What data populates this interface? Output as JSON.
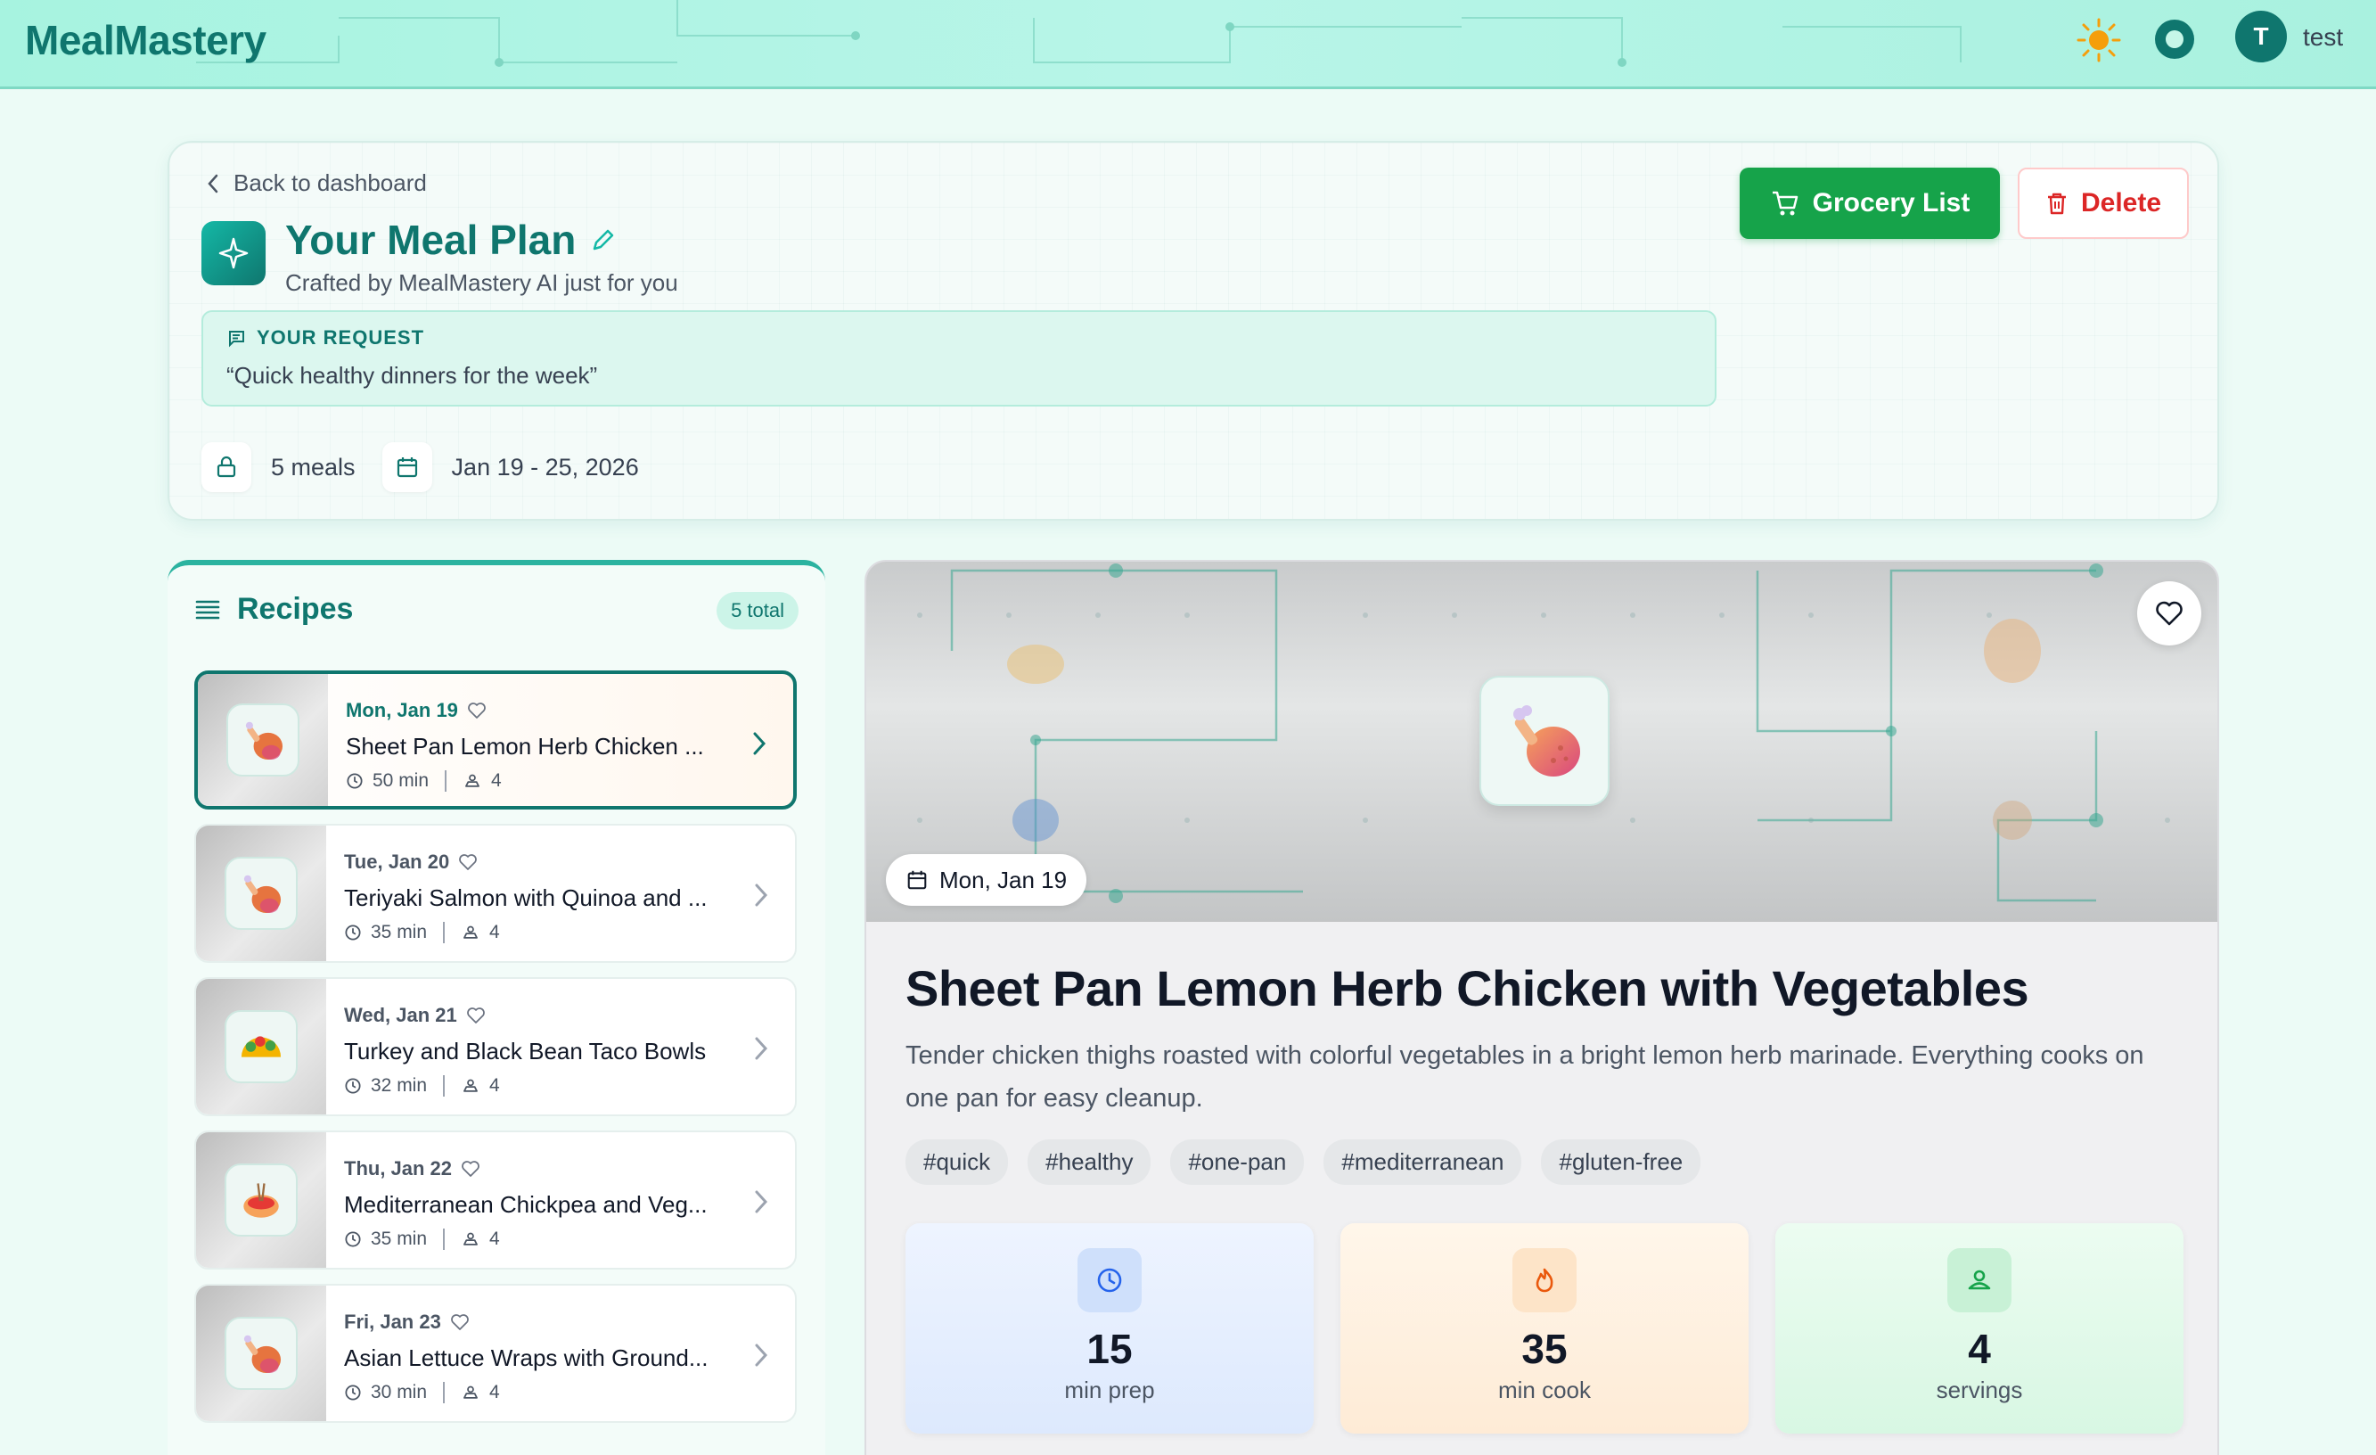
{
  "app": {
    "brand": "MealMastery"
  },
  "user": {
    "initial": "T",
    "name": "test"
  },
  "header": {
    "back_label": "Back to dashboard",
    "title": "Your Meal Plan",
    "subtitle": "Crafted by MealMastery AI just for you",
    "request_label": "YOUR REQUEST",
    "request_text": "“Quick healthy dinners for the week”",
    "meals_count": "5 meals",
    "date_range": "Jan 19 - 25, 2026",
    "grocery_label": "Grocery List",
    "delete_label": "Delete"
  },
  "recipes": {
    "heading": "Recipes",
    "total_badge": "5 total",
    "items": [
      {
        "day": "Mon, Jan 19",
        "name": "Sheet Pan Lemon Herb Chicken ...",
        "time": "50 min",
        "servings": "4",
        "icon": "chicken-leg-icon"
      },
      {
        "day": "Tue, Jan 20",
        "name": "Teriyaki Salmon with Quinoa and ...",
        "time": "35 min",
        "servings": "4",
        "icon": "chicken-leg-icon"
      },
      {
        "day": "Wed, Jan 21",
        "name": "Turkey and Black Bean Taco Bowls",
        "time": "32 min",
        "servings": "4",
        "icon": "taco-icon"
      },
      {
        "day": "Thu, Jan 22",
        "name": "Mediterranean Chickpea and Veg...",
        "time": "35 min",
        "servings": "4",
        "icon": "noodle-bowl-icon"
      },
      {
        "day": "Fri, Jan 23",
        "name": "Asian Lettuce Wraps with Ground...",
        "time": "30 min",
        "servings": "4",
        "icon": "chicken-leg-icon"
      }
    ]
  },
  "detail": {
    "date": "Mon, Jan 19",
    "title": "Sheet Pan Lemon Herb Chicken with Vegetables",
    "description": "Tender chicken thighs roasted with colorful vegetables in a bright lemon herb marinade. Everything cooks on one pan for easy cleanup.",
    "tags": [
      "#quick",
      "#healthy",
      "#one-pan",
      "#mediterranean",
      "#gluten-free"
    ],
    "stats": [
      {
        "value": "15",
        "label": "min prep",
        "icon": "clock-icon"
      },
      {
        "value": "35",
        "label": "min cook",
        "icon": "flame-icon"
      },
      {
        "value": "4",
        "label": "servings",
        "icon": "user-icon"
      }
    ]
  },
  "colors": {
    "brand": "#0f766e",
    "grocery": "#16a34a",
    "delete": "#dc2626"
  }
}
